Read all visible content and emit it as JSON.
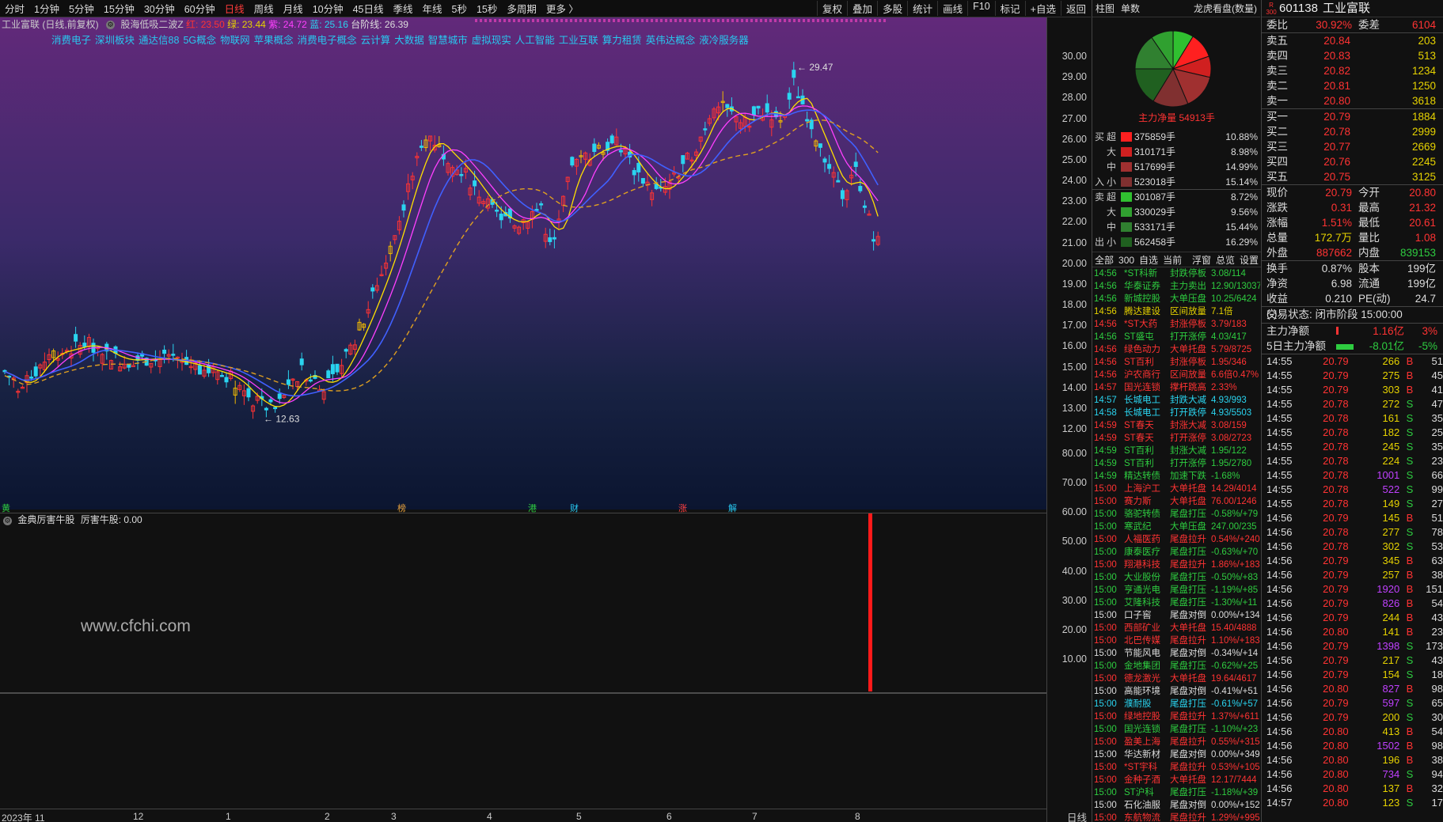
{
  "toolbar": {
    "periods": [
      "分时",
      "1分钟",
      "5分钟",
      "15分钟",
      "30分钟",
      "60分钟",
      "日线",
      "周线",
      "月线",
      "10分钟",
      "45日线",
      "季线",
      "年线",
      "5秒",
      "15秒",
      "多周期",
      "更多 〉"
    ],
    "active": "日线",
    "right": [
      "复权",
      "叠加",
      "多股",
      "统计",
      "画线",
      "F10",
      "标记",
      "+自选",
      "返回"
    ]
  },
  "main": {
    "title": "工业富联 (日线,前复权)",
    "indicator": "股海低吸二波Z",
    "red_label": "红: 23.50",
    "green_label": "绿: 23.44",
    "purple_label": "紫: 24.72",
    "blue_label": "蓝: 25.16",
    "step_label": "台阶线: 26.39",
    "concepts": [
      "消费电子",
      "深圳板块",
      "通达信88",
      "5G概念",
      "物联网",
      "苹果概念",
      "消费电子概念",
      "云计算",
      "大数据",
      "智慧城市",
      "虚拟现实",
      "人工智能",
      "工业互联",
      "算力租赁",
      "英伟达概念",
      "液冷服务器"
    ],
    "max_label": "29.47",
    "min_label": "12.63",
    "yticks": [
      "30.00",
      "29.00",
      "28.00",
      "27.00",
      "26.00",
      "25.00",
      "24.00",
      "23.00",
      "22.00",
      "21.00",
      "20.00",
      "19.00",
      "18.00",
      "17.00",
      "16.00",
      "15.00",
      "14.00",
      "13.00",
      "12.00"
    ],
    "markers": [
      {
        "text": "榜",
        "color": "#e9a23b"
      },
      {
        "text": "港",
        "color": "#2ecc40"
      },
      {
        "text": "财",
        "color": "#28c8f0"
      },
      {
        "text": "涨",
        "color": "#ff4040"
      },
      {
        "text": "解",
        "color": "#28c8f0"
      },
      {
        "text": "黄",
        "color": "#2ecc40"
      }
    ]
  },
  "lower": {
    "title": "金典厉害牛股",
    "value_label": "厉害牛股: 0.00",
    "yticks": [
      "80.00",
      "70.00",
      "60.00",
      "50.00",
      "40.00",
      "30.00",
      "20.00",
      "10.00"
    ],
    "watermark": "www.cfchi.com"
  },
  "xaxis": {
    "labels": [
      "2023年 11",
      "12",
      "1",
      "2",
      "3",
      "4",
      "5",
      "6",
      "7",
      "8"
    ],
    "period_label": "日线"
  },
  "flow": {
    "tabs": [
      "柱图",
      "单数"
    ],
    "title": "龙虎看盘(数量)",
    "net_label": "主力净量 54913手",
    "buy_side": "买",
    "sell_side": "卖",
    "in_label": "入",
    "out_label": "出",
    "rows": [
      {
        "size": "超",
        "vol": "375859手",
        "pct": "10.88%",
        "color": "#ff2020"
      },
      {
        "size": "大",
        "vol": "310171手",
        "pct": "8.98%",
        "color": "#d02020"
      },
      {
        "size": "中",
        "vol": "517699手",
        "pct": "14.99%",
        "color": "#a03030"
      },
      {
        "size": "小",
        "vol": "523018手",
        "pct": "15.14%",
        "color": "#803030"
      },
      {
        "size": "超",
        "vol": "301087手",
        "pct": "8.72%",
        "color": "#30c030"
      },
      {
        "size": "大",
        "vol": "330029手",
        "pct": "9.56%",
        "color": "#30a030"
      },
      {
        "size": "中",
        "vol": "533171手",
        "pct": "15.44%",
        "color": "#308030"
      },
      {
        "size": "小",
        "vol": "562458手",
        "pct": "16.29%",
        "color": "#206020"
      }
    ]
  },
  "events_tabs": [
    "全部",
    "300",
    "自选",
    "当前",
    "浮窗",
    "总览",
    "设置"
  ],
  "events": [
    {
      "t": "14:56",
      "n": "*ST科新",
      "k": "封跌停板",
      "v": "3.08/114",
      "c": "green"
    },
    {
      "t": "14:56",
      "n": "华泰证券",
      "k": "主力卖出",
      "v": "12.90/13037",
      "c": "green"
    },
    {
      "t": "14:56",
      "n": "新城控股",
      "k": "大单压盘",
      "v": "10.25/6424",
      "c": "green"
    },
    {
      "t": "14:56",
      "n": "腾达建设",
      "k": "区间放量",
      "v": "7.1倍",
      "c": "yellow"
    },
    {
      "t": "14:56",
      "n": "*ST大药",
      "k": "封涨停板",
      "v": "3.79/183",
      "c": "red"
    },
    {
      "t": "14:56",
      "n": "ST盛屯",
      "k": "打开涨停",
      "v": "4.03/417",
      "c": "green"
    },
    {
      "t": "14:56",
      "n": "绿色动力",
      "k": "大单托盘",
      "v": "5.79/8725",
      "c": "red"
    },
    {
      "t": "14:56",
      "n": "ST百利",
      "k": "封涨停板",
      "v": "1.95/346",
      "c": "red"
    },
    {
      "t": "14:56",
      "n": "沪农商行",
      "k": "区间放量",
      "v": "6.6倍0.47%",
      "c": "red"
    },
    {
      "t": "14:57",
      "n": "国光连锁",
      "k": "撑杆跳高",
      "v": "2.33%",
      "c": "red"
    },
    {
      "t": "14:57",
      "n": "长城电工",
      "k": "封跌大减",
      "v": "4.93/993",
      "c": "cyan"
    },
    {
      "t": "14:58",
      "n": "长城电工",
      "k": "打开跌停",
      "v": "4.93/5503",
      "c": "cyan"
    },
    {
      "t": "14:59",
      "n": "ST春天",
      "k": "封涨大减",
      "v": "3.08/159",
      "c": "red"
    },
    {
      "t": "14:59",
      "n": "ST春天",
      "k": "打开涨停",
      "v": "3.08/2723",
      "c": "red"
    },
    {
      "t": "14:59",
      "n": "ST百利",
      "k": "封涨大减",
      "v": "1.95/122",
      "c": "green"
    },
    {
      "t": "14:59",
      "n": "ST百利",
      "k": "打开涨停",
      "v": "1.95/2780",
      "c": "green"
    },
    {
      "t": "14:59",
      "n": "精达转债",
      "k": "加速下跌",
      "v": "-1.68%",
      "c": "green"
    },
    {
      "t": "15:00",
      "n": "上海沪工",
      "k": "大单托盘",
      "v": "14.29/4014",
      "c": "red"
    },
    {
      "t": "15:00",
      "n": "赛力斯",
      "k": "大单托盘",
      "v": "76.00/1246",
      "c": "red"
    },
    {
      "t": "15:00",
      "n": "骆驼转债",
      "k": "尾盘打压",
      "v": "-0.58%/+79",
      "c": "green"
    },
    {
      "t": "15:00",
      "n": "寒武纪",
      "k": "大单压盘",
      "v": "247.00/235",
      "c": "green"
    },
    {
      "t": "15:00",
      "n": "人福医药",
      "k": "尾盘拉升",
      "v": "0.54%/+240",
      "c": "red"
    },
    {
      "t": "15:00",
      "n": "康泰医疗",
      "k": "尾盘打压",
      "v": "-0.63%/+70",
      "c": "green"
    },
    {
      "t": "15:00",
      "n": "翔港科技",
      "k": "尾盘拉升",
      "v": "1.86%/+183",
      "c": "red"
    },
    {
      "t": "15:00",
      "n": "大业股份",
      "k": "尾盘打压",
      "v": "-0.50%/+83",
      "c": "green"
    },
    {
      "t": "15:00",
      "n": "亨通光电",
      "k": "尾盘打压",
      "v": "-1.19%/+85",
      "c": "green"
    },
    {
      "t": "15:00",
      "n": "艾隆科技",
      "k": "尾盘打压",
      "v": "-1.30%/+11",
      "c": "green"
    },
    {
      "t": "15:00",
      "n": "口子窖",
      "k": "尾盘对倒",
      "v": "0.00%/+134",
      "c": "white"
    },
    {
      "t": "15:00",
      "n": "西部矿业",
      "k": "大单托盘",
      "v": "15.40/4888",
      "c": "red"
    },
    {
      "t": "15:00",
      "n": "北巴传媒",
      "k": "尾盘拉升",
      "v": "1.10%/+183",
      "c": "red"
    },
    {
      "t": "15:00",
      "n": "节能风电",
      "k": "尾盘对倒",
      "v": "-0.34%/+14",
      "c": "white"
    },
    {
      "t": "15:00",
      "n": "金地集团",
      "k": "尾盘打压",
      "v": "-0.62%/+25",
      "c": "green"
    },
    {
      "t": "15:00",
      "n": "德龙激光",
      "k": "大单托盘",
      "v": "19.64/4617",
      "c": "red"
    },
    {
      "t": "15:00",
      "n": "高能环境",
      "k": "尾盘对倒",
      "v": "-0.41%/+51",
      "c": "white"
    },
    {
      "t": "15:00",
      "n": "濮耐股",
      "k": "尾盘打压",
      "v": "-0.61%/+57",
      "c": "cyan"
    },
    {
      "t": "15:00",
      "n": "绿地控股",
      "k": "尾盘拉升",
      "v": "1.37%/+611",
      "c": "red"
    },
    {
      "t": "15:00",
      "n": "国光连锁",
      "k": "尾盘打压",
      "v": "-1.10%/+23",
      "c": "green"
    },
    {
      "t": "15:00",
      "n": "盈美上海",
      "k": "尾盘拉升",
      "v": "0.55%/+315",
      "c": "red"
    },
    {
      "t": "15:00",
      "n": "华达新材",
      "k": "尾盘对倒",
      "v": "0.00%/+349",
      "c": "white"
    },
    {
      "t": "15:00",
      "n": "*ST宇科",
      "k": "尾盘拉升",
      "v": "0.53%/+105",
      "c": "red"
    },
    {
      "t": "15:00",
      "n": "金种子酒",
      "k": "大单托盘",
      "v": "12.17/7444",
      "c": "red"
    },
    {
      "t": "15:00",
      "n": "ST沪科",
      "k": "尾盘打压",
      "v": "-1.18%/+39",
      "c": "green"
    },
    {
      "t": "15:00",
      "n": "石化油服",
      "k": "尾盘对倒",
      "v": "0.00%/+152",
      "c": "white"
    },
    {
      "t": "15:00",
      "n": "东航物流",
      "k": "尾盘拉升",
      "v": "1.29%/+995",
      "c": "red"
    }
  ],
  "quote": {
    "badge_top": "R",
    "badge_bottom": "300",
    "code": "601138",
    "name": "工业富联",
    "weibi_label": "委比",
    "weibi": "30.92%",
    "weicha_label": "委差",
    "weicha": "6104",
    "asks": [
      {
        "l": "卖五",
        "p": "20.84",
        "v": "203"
      },
      {
        "l": "卖四",
        "p": "20.83",
        "v": "513"
      },
      {
        "l": "卖三",
        "p": "20.82",
        "v": "1234"
      },
      {
        "l": "卖二",
        "p": "20.81",
        "v": "1250"
      },
      {
        "l": "卖一",
        "p": "20.80",
        "v": "3618"
      }
    ],
    "bids": [
      {
        "l": "买一",
        "p": "20.79",
        "v": "1884"
      },
      {
        "l": "买二",
        "p": "20.78",
        "v": "2999"
      },
      {
        "l": "买三",
        "p": "20.77",
        "v": "2669"
      },
      {
        "l": "买四",
        "p": "20.76",
        "v": "2245"
      },
      {
        "l": "买五",
        "p": "20.75",
        "v": "3125"
      }
    ],
    "stats": [
      [
        {
          "l": "现价",
          "v": "20.79",
          "c": "red"
        },
        {
          "l": "今开",
          "v": "20.80",
          "c": "red"
        }
      ],
      [
        {
          "l": "涨跌",
          "v": "0.31",
          "c": "red"
        },
        {
          "l": "最高",
          "v": "21.32",
          "c": "red"
        }
      ],
      [
        {
          "l": "涨幅",
          "v": "1.51%",
          "c": "red"
        },
        {
          "l": "最低",
          "v": "20.61",
          "c": "red"
        }
      ],
      [
        {
          "l": "总量",
          "v": "172.7万",
          "c": "yellow"
        },
        {
          "l": "量比",
          "v": "1.08",
          "c": "red"
        }
      ],
      [
        {
          "l": "外盘",
          "v": "887662",
          "c": "red"
        },
        {
          "l": "内盘",
          "v": "839153",
          "c": "green"
        }
      ]
    ],
    "stats2": [
      [
        {
          "l": "换手",
          "v": "0.87%",
          "c": "white"
        },
        {
          "l": "股本",
          "v": "199亿",
          "c": "white"
        }
      ],
      [
        {
          "l": "净资",
          "v": "6.98",
          "c": "white"
        },
        {
          "l": "流通",
          "v": "199亿",
          "c": "white"
        }
      ],
      [
        {
          "l": "收益(-)",
          "v": "0.210",
          "c": "white"
        },
        {
          "l": "PE(动)",
          "v": "24.7",
          "c": "white"
        }
      ]
    ],
    "status": "交易状态: 闭市阶段 15:00:00",
    "net1_label": "主力净额",
    "net1_val": "1.16亿",
    "net1_pct": "3%",
    "net2_label": "5日主力净额",
    "net2_val": "-8.01亿",
    "net2_pct": "-5%"
  },
  "ticks": [
    {
      "t": "14:55",
      "p": "20.79",
      "v": "266",
      "bs": "B",
      "n": "51"
    },
    {
      "t": "14:55",
      "p": "20.79",
      "v": "275",
      "bs": "B",
      "n": "45"
    },
    {
      "t": "14:55",
      "p": "20.79",
      "v": "303",
      "bs": "B",
      "n": "41"
    },
    {
      "t": "14:55",
      "p": "20.78",
      "v": "272",
      "bs": "S",
      "n": "47"
    },
    {
      "t": "14:55",
      "p": "20.78",
      "v": "161",
      "bs": "S",
      "n": "35"
    },
    {
      "t": "14:55",
      "p": "20.78",
      "v": "182",
      "bs": "S",
      "n": "25"
    },
    {
      "t": "14:55",
      "p": "20.78",
      "v": "245",
      "bs": "S",
      "n": "35"
    },
    {
      "t": "14:55",
      "p": "20.78",
      "v": "224",
      "bs": "S",
      "n": "23"
    },
    {
      "t": "14:55",
      "p": "20.78",
      "v": "1001",
      "bs": "S",
      "n": "66"
    },
    {
      "t": "14:55",
      "p": "20.78",
      "v": "522",
      "bs": "S",
      "n": "99"
    },
    {
      "t": "14:55",
      "p": "20.78",
      "v": "149",
      "bs": "S",
      "n": "27"
    },
    {
      "t": "14:56",
      "p": "20.79",
      "v": "145",
      "bs": "B",
      "n": "51"
    },
    {
      "t": "14:56",
      "p": "20.78",
      "v": "277",
      "bs": "S",
      "n": "78"
    },
    {
      "t": "14:56",
      "p": "20.78",
      "v": "302",
      "bs": "S",
      "n": "53"
    },
    {
      "t": "14:56",
      "p": "20.79",
      "v": "345",
      "bs": "B",
      "n": "63"
    },
    {
      "t": "14:56",
      "p": "20.79",
      "v": "257",
      "bs": "B",
      "n": "38"
    },
    {
      "t": "14:56",
      "p": "20.79",
      "v": "1920",
      "bs": "B",
      "n": "151"
    },
    {
      "t": "14:56",
      "p": "20.79",
      "v": "826",
      "bs": "B",
      "n": "54"
    },
    {
      "t": "14:56",
      "p": "20.79",
      "v": "244",
      "bs": "B",
      "n": "43"
    },
    {
      "t": "14:56",
      "p": "20.80",
      "v": "141",
      "bs": "B",
      "n": "23"
    },
    {
      "t": "14:56",
      "p": "20.79",
      "v": "1398",
      "bs": "S",
      "n": "173"
    },
    {
      "t": "14:56",
      "p": "20.79",
      "v": "217",
      "bs": "S",
      "n": "43"
    },
    {
      "t": "14:56",
      "p": "20.79",
      "v": "154",
      "bs": "S",
      "n": "18"
    },
    {
      "t": "14:56",
      "p": "20.80",
      "v": "827",
      "bs": "B",
      "n": "98"
    },
    {
      "t": "14:56",
      "p": "20.79",
      "v": "597",
      "bs": "S",
      "n": "65"
    },
    {
      "t": "14:56",
      "p": "20.79",
      "v": "200",
      "bs": "S",
      "n": "30"
    },
    {
      "t": "14:56",
      "p": "20.80",
      "v": "413",
      "bs": "B",
      "n": "54"
    },
    {
      "t": "14:56",
      "p": "20.80",
      "v": "1502",
      "bs": "B",
      "n": "98"
    },
    {
      "t": "14:56",
      "p": "20.80",
      "v": "196",
      "bs": "B",
      "n": "38"
    },
    {
      "t": "14:56",
      "p": "20.80",
      "v": "734",
      "bs": "S",
      "n": "94"
    },
    {
      "t": "14:56",
      "p": "20.80",
      "v": "137",
      "bs": "B",
      "n": "32"
    },
    {
      "t": "14:57",
      "p": "20.80",
      "v": "123",
      "bs": "S",
      "n": "17"
    }
  ],
  "colors": {
    "up": "#ff3333",
    "down": "#2ad4f0",
    "yang": "#f0b800"
  }
}
